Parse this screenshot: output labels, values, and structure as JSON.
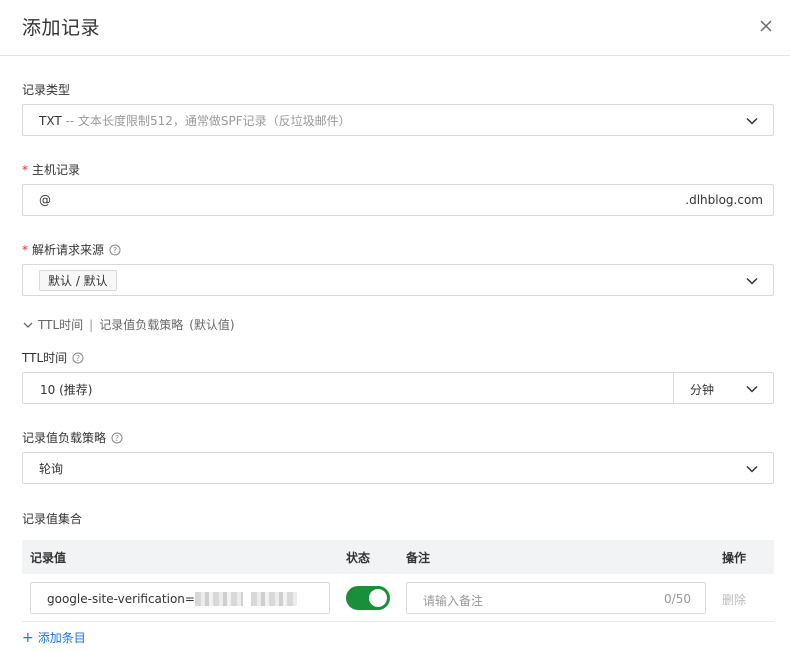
{
  "dialog": {
    "title": "添加记录"
  },
  "record_type": {
    "label": "记录类型",
    "value": "TXT",
    "description": " -- 文本长度限制512，通常做SPF记录（反垃圾邮件）"
  },
  "host_record": {
    "label": "主机记录",
    "value": "@",
    "suffix": ".dlhblog.com"
  },
  "resolve_source": {
    "label": "解析请求来源",
    "tag": "默认 / 默认"
  },
  "advanced": {
    "ttl_label": "TTL时间",
    "separator": "|",
    "policy_label": "记录值负载策略",
    "default_hint": "(默认值)"
  },
  "ttl": {
    "label": "TTL时间",
    "value": "10 (推荐)",
    "unit": "分钟"
  },
  "load_policy": {
    "label": "记录值负载策略",
    "value": "轮询"
  },
  "record_set": {
    "title": "记录值集合",
    "columns": {
      "value": "记录值",
      "status": "状态",
      "note": "备注",
      "action": "操作"
    },
    "rows": [
      {
        "value": "google-site-verification=",
        "note_placeholder": "请输入备注",
        "note_count": "0/50",
        "delete_label": "删除"
      }
    ],
    "add_label": "添加条目"
  },
  "colors": {
    "toggle_on": "#1a8f3a",
    "link": "#1a73e8",
    "required": "#f5222d"
  }
}
